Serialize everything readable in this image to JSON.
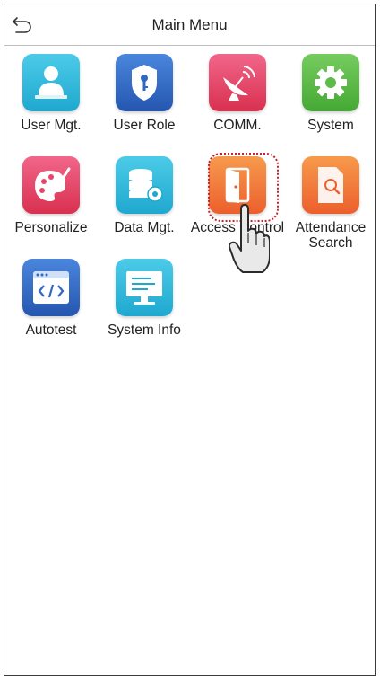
{
  "header": {
    "title": "Main Menu",
    "back_icon": "back-arrow-icon"
  },
  "menu": {
    "items": [
      {
        "label": "User Mgt.",
        "icon": "user-icon",
        "color": "#2fb7d9"
      },
      {
        "label": "User Role",
        "icon": "shield-key-icon",
        "color": "#2f67c2"
      },
      {
        "label": "COMM.",
        "icon": "satellite-dish-icon",
        "color": "#e8456a"
      },
      {
        "label": "System",
        "icon": "gear-icon",
        "color": "#5dbb4a"
      },
      {
        "label": "Personalize",
        "icon": "palette-icon",
        "color": "#e8456a"
      },
      {
        "label": "Data Mgt.",
        "icon": "database-gear-icon",
        "color": "#2fb7d9"
      },
      {
        "label": "Access Control",
        "icon": "door-icon",
        "color": "#f07a3a"
      },
      {
        "label": "Attendance\nSearch",
        "icon": "document-search-icon",
        "color": "#f07a3a"
      },
      {
        "label": "Autotest",
        "icon": "code-window-icon",
        "color": "#2f67c2"
      },
      {
        "label": "System Info",
        "icon": "monitor-icon",
        "color": "#2fb7d9"
      }
    ]
  }
}
